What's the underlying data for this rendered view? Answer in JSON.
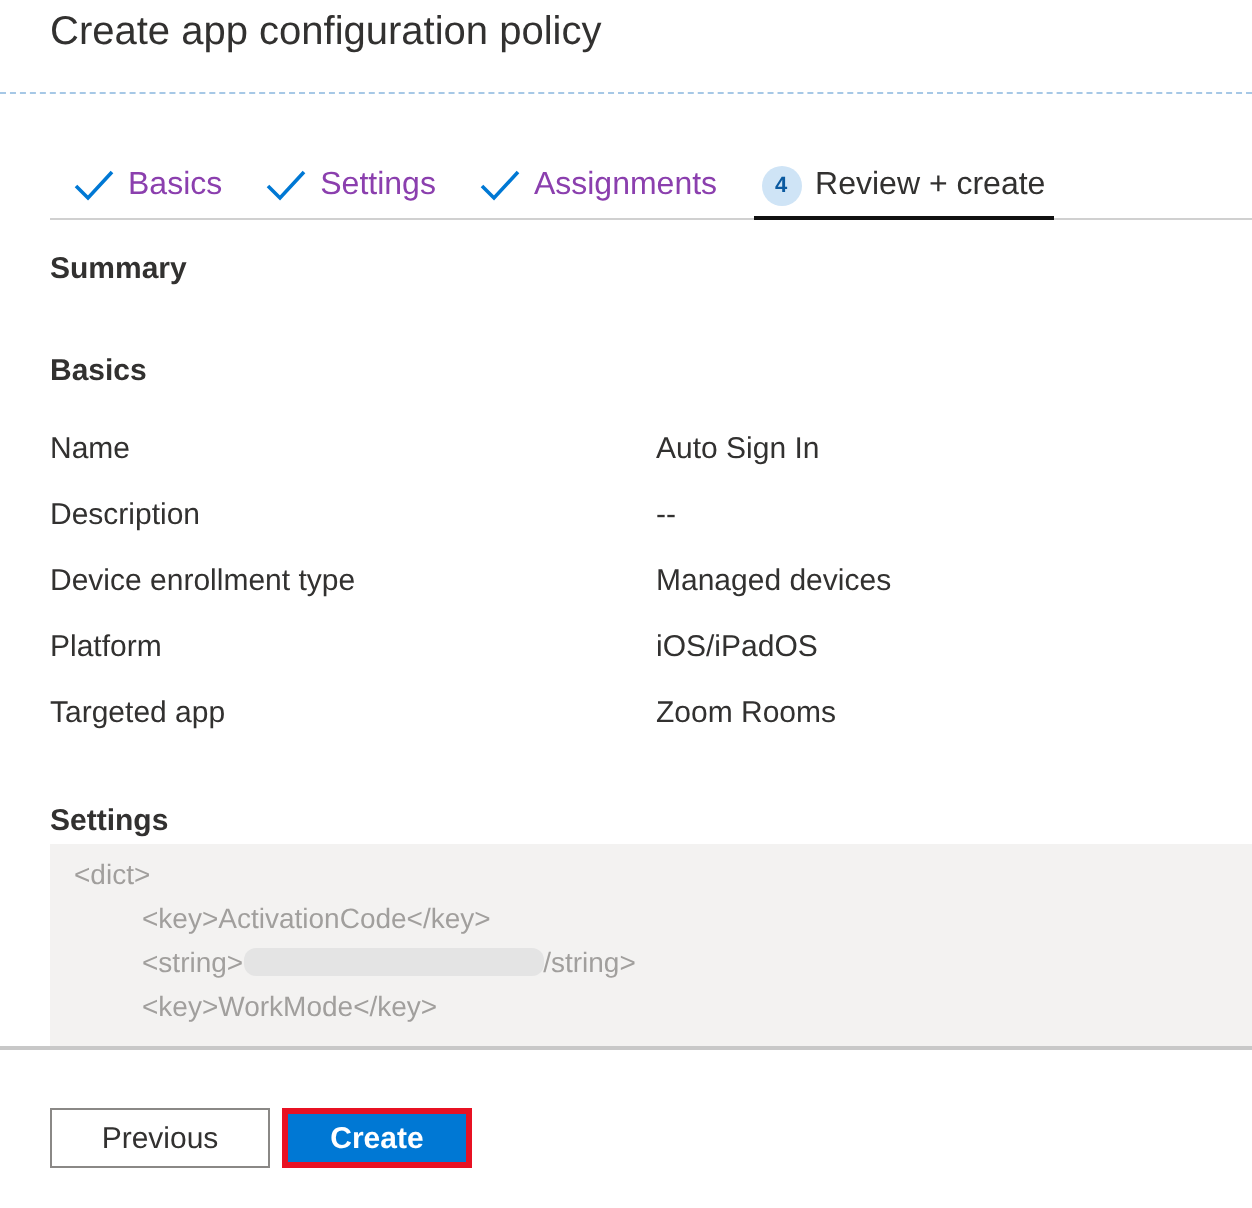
{
  "window": {
    "title": "Create app configuration policy"
  },
  "tabs": [
    {
      "label": "Basics",
      "kind": "done",
      "selected": false
    },
    {
      "label": "Settings",
      "kind": "done",
      "selected": false
    },
    {
      "label": "Assignments",
      "kind": "done",
      "selected": false
    },
    {
      "label": "Review + create",
      "kind": "step",
      "number": "4",
      "selected": true
    }
  ],
  "summary": {
    "title": "Summary"
  },
  "basics": {
    "title": "Basics",
    "rows": [
      {
        "label": "Name",
        "value": "Auto Sign In"
      },
      {
        "label": "Description",
        "value": "--"
      },
      {
        "label": "Device enrollment type",
        "value": "Managed devices"
      },
      {
        "label": "Platform",
        "value": "iOS/iPadOS"
      },
      {
        "label": "Targeted app",
        "value": "Zoom Rooms"
      }
    ]
  },
  "settings": {
    "title": "Settings",
    "lines": [
      {
        "text": "<dict>",
        "indent": false,
        "redacted": false
      },
      {
        "text": "<key>ActivationCode</key>",
        "indent": true,
        "redacted": false
      },
      {
        "text": "<string>",
        "after": "/string>",
        "indent": true,
        "redacted": true
      },
      {
        "text": "<key>WorkMode</key>",
        "indent": true,
        "redacted": false
      }
    ]
  },
  "buttons": [
    {
      "label": "Previous",
      "kind": "secondary",
      "highlighted": false
    },
    {
      "label": "Create",
      "kind": "primary",
      "highlighted": true
    }
  ]
}
